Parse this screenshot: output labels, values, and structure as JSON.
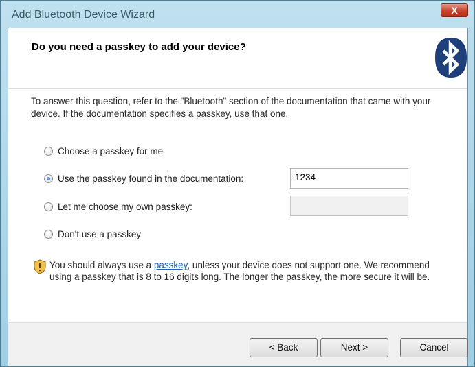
{
  "window": {
    "title": "Add Bluetooth Device Wizard",
    "close_glyph": "X"
  },
  "header": {
    "title": "Do you need a passkey to add your device?",
    "logo_icon": "bluetooth-icon"
  },
  "description": "To answer this question, refer to the \"Bluetooth\" section of the documentation that came with your device. If the documentation specifies a passkey, use that one.",
  "options": [
    {
      "label": "Choose a passkey for me",
      "checked": false
    },
    {
      "label": "Use the passkey found in the documentation:",
      "checked": true,
      "value": "1234"
    },
    {
      "label": "Let me choose my own passkey:",
      "checked": false,
      "value": ""
    },
    {
      "label": "Don't use a passkey",
      "checked": false
    }
  ],
  "warning": {
    "icon": "shield-warning-icon",
    "prefix": "You should always use a ",
    "link": "passkey",
    "suffix": ", unless your device does not support one. We recommend using a passkey that is 8 to 16 digits long. The longer the passkey, the more secure it will be."
  },
  "buttons": {
    "back": "< Back",
    "next": "Next >",
    "cancel": "Cancel"
  },
  "colors": {
    "link": "#1c62b8",
    "bluetooth": "#1e3f7a",
    "titlebar": "#aed8ea"
  }
}
